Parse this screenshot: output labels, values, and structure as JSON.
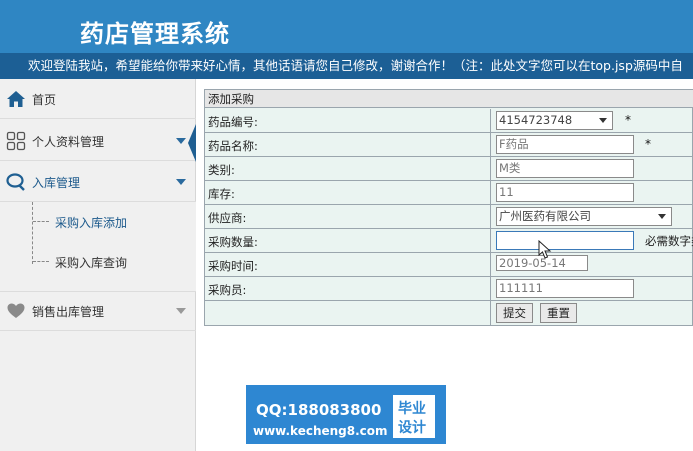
{
  "header": {
    "title": "药店管理系统",
    "marquee": "欢迎登陆我站，希望能给你带来好心情，其他话语请您自己修改，谢谢合作！（注：此处文字您可以在top.jsp源码中自"
  },
  "sidebar": {
    "items": [
      {
        "label": "首页",
        "icon": "home-icon"
      },
      {
        "label": "个人资料管理",
        "icon": "grid-icon"
      },
      {
        "label": "入库管理",
        "icon": "chat-icon"
      },
      {
        "label": "销售出库管理",
        "icon": "heart-icon"
      }
    ],
    "sub_items": [
      {
        "label": "采购入库添加"
      },
      {
        "label": "采购入库查询"
      }
    ]
  },
  "form": {
    "heading": "添加采购",
    "fields": [
      {
        "label": "药品编号:",
        "value": "4154723748",
        "type": "select",
        "required": "*"
      },
      {
        "label": "药品名称:",
        "value": "F药品",
        "type": "input",
        "required": "*"
      },
      {
        "label": "类别:",
        "value": "M类",
        "type": "input"
      },
      {
        "label": "库存:",
        "value": "11",
        "type": "input"
      },
      {
        "label": "供应商:",
        "value": "广州医药有限公司",
        "type": "select"
      },
      {
        "label": "采购数量:",
        "value": "",
        "type": "input",
        "hint": "必需数字类"
      },
      {
        "label": "采购时间:",
        "value": "2019-05-14",
        "type": "input"
      },
      {
        "label": "采购员:",
        "value": "111111",
        "type": "input"
      }
    ],
    "submit_label": "提交",
    "reset_label": "重置"
  },
  "watermark": {
    "qq": "QQ:188083800",
    "url": "www.kecheng8.com",
    "badge_line1": "毕业",
    "badge_line2": "设计"
  },
  "colors": {
    "header_bg": "#2f86c3",
    "marquee_bg": "#1c5f95",
    "form_bg": "#eaf4f1",
    "watermark_bg": "#2e87d2"
  }
}
